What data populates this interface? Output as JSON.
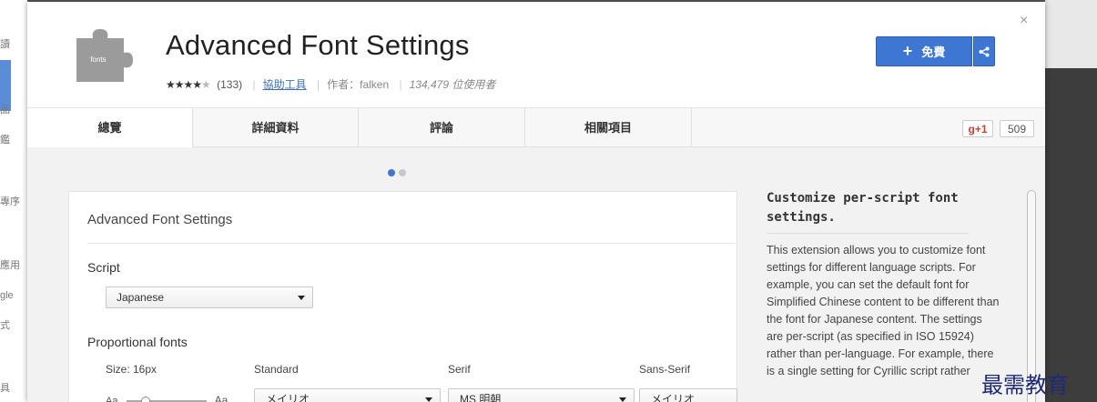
{
  "background": {
    "left_labels": [
      "讀",
      "品",
      "鑑",
      "專序",
      "應用",
      "gle",
      "式",
      "具"
    ]
  },
  "extension": {
    "icon_label": "fonts",
    "title": "Advanced Font Settings",
    "stars_on": "★★★★",
    "stars_off": "★",
    "rating_count": "(133)",
    "category": "協助工具",
    "author": "作者：falken",
    "users": "134,479 位使用者"
  },
  "actions": {
    "add_label": "免費",
    "close": "×"
  },
  "tabs": [
    {
      "label": "總覽"
    },
    {
      "label": "詳細資料"
    },
    {
      "label": "評論"
    },
    {
      "label": "相關項目"
    }
  ],
  "social": {
    "gplus_label": "g+1",
    "gplus_count": "509"
  },
  "screenshot": {
    "title": "Advanced Font Settings",
    "script_label": "Script",
    "script_value": "Japanese",
    "proportional_label": "Proportional fonts",
    "size_label": "Size: 16px",
    "col_standard": "Standard",
    "col_serif": "Serif",
    "col_sans": "Sans-Serif",
    "slider_small": "Aa",
    "slider_large": "Aa",
    "standard_value": "メイリオ",
    "serif_value": "MS 明朝",
    "sans_value": "メイリオ"
  },
  "description": {
    "heading": "Customize per-script font settings.",
    "body": "This extension allows you to customize font settings for different language scripts. For example, you can set the default font for Simplified Chinese content to be different than the font for Japanese content. The settings are per-script (as specified in ISO 15924) rather than per-language. For example, there is a single setting for Cyrillic script rather"
  },
  "colors": {
    "accent": "#3e76d4",
    "dot_active": "#3e76d4",
    "dot_inactive": "#c8c8c8",
    "gplus": "#d23f31"
  },
  "watermark": "最需教育"
}
